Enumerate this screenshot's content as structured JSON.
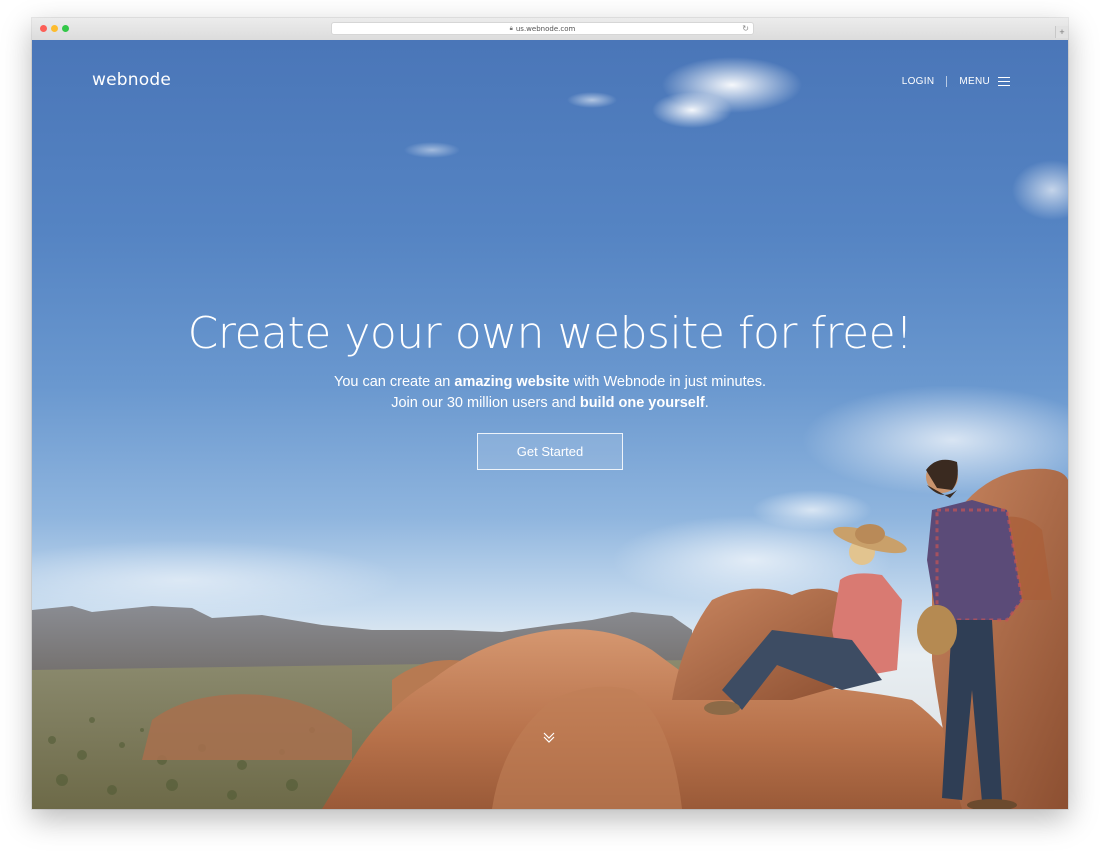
{
  "browser": {
    "url": "us.webnode.com"
  },
  "header": {
    "logo_text": "webnode",
    "login_label": "LOGIN",
    "menu_label": "MENU"
  },
  "hero": {
    "title": "Create your own website for free!",
    "subtitle_line1": {
      "pre": "You can create an ",
      "bold": "amazing website",
      "post": " with Webnode in just minutes."
    },
    "subtitle_line2": {
      "pre": "Join our 30 million users and ",
      "bold": "build one yourself",
      "post": "."
    },
    "cta_label": "Get Started"
  },
  "icons": {
    "menu": "hamburger-icon",
    "scroll": "chevron-down-icon",
    "lock": "lock-icon",
    "reload": "reload-icon"
  }
}
